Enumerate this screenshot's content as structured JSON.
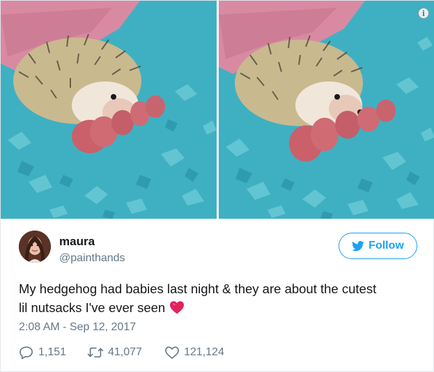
{
  "photos": [
    {
      "alt_icon": "info-icon",
      "show_info": false
    },
    {
      "alt_icon": "info-icon",
      "show_info": true
    }
  ],
  "info_glyph": "i",
  "user": {
    "name": "maura",
    "handle": "@painthands",
    "follow_label": "Follow"
  },
  "tweet": {
    "text_line1": "My hedgehog had babies last night & they are about the cutest",
    "text_line2": "lil nutsacks I've ever seen",
    "emoji": "heart-emoji",
    "timestamp": "2:08 AM - Sep 12, 2017"
  },
  "stats": {
    "replies": "1,151",
    "retweets": "41,077",
    "likes": "121,124"
  },
  "colors": {
    "accent": "#1da1f2",
    "muted": "#657786",
    "text": "#14171a",
    "bedding": "#46b8c8",
    "emoji": "#e0245e"
  }
}
